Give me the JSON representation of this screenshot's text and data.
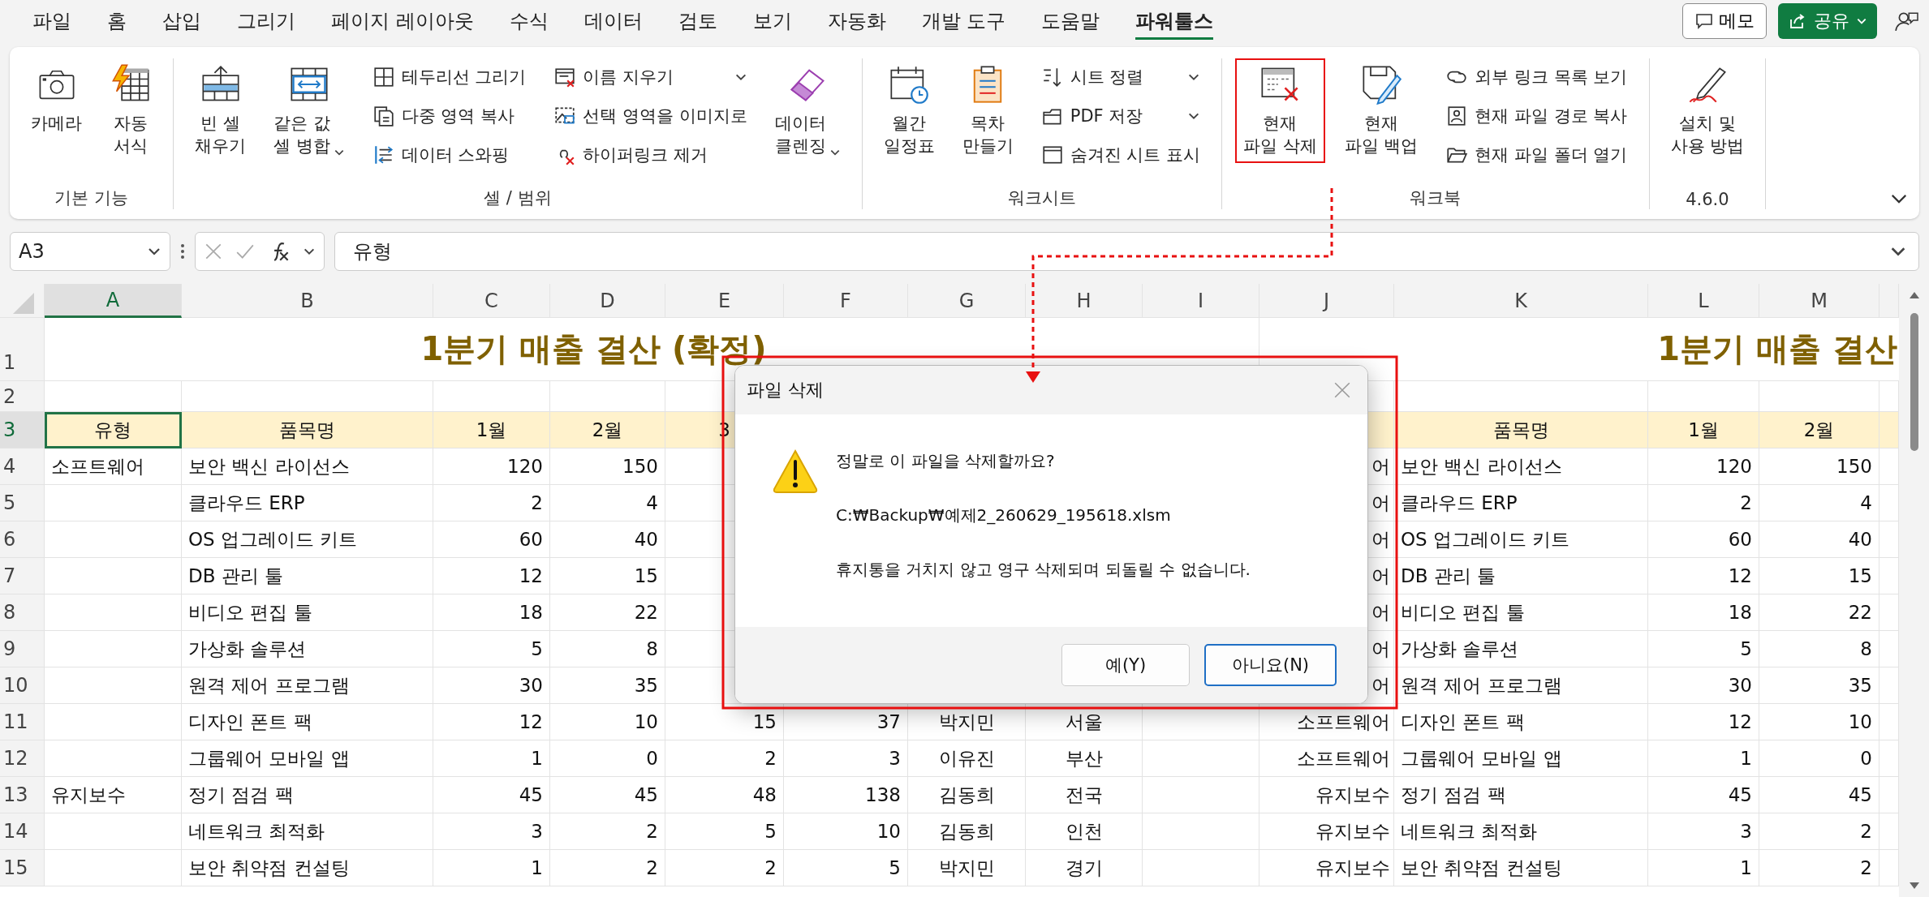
{
  "menu_tabs": [
    {
      "label": "파일",
      "selected": false
    },
    {
      "label": "홈",
      "selected": false
    },
    {
      "label": "삽입",
      "selected": false
    },
    {
      "label": "그리기",
      "selected": false
    },
    {
      "label": "페이지 레이아웃",
      "selected": false
    },
    {
      "label": "수식",
      "selected": false
    },
    {
      "label": "데이터",
      "selected": false
    },
    {
      "label": "검토",
      "selected": false
    },
    {
      "label": "보기",
      "selected": false
    },
    {
      "label": "자동화",
      "selected": false
    },
    {
      "label": "개발 도구",
      "selected": false
    },
    {
      "label": "도움말",
      "selected": false
    },
    {
      "label": "파워툴스",
      "selected": true
    }
  ],
  "header_buttons": {
    "memo": "메모",
    "share": "공유"
  },
  "ribbon": {
    "groups": [
      {
        "name": "기본 기능",
        "items": [
          {
            "kind": "large",
            "label": "카메라",
            "has_menu": false,
            "highlighted": false
          },
          {
            "kind": "large",
            "label": "자동\n서식",
            "has_menu": false,
            "highlighted": false
          }
        ]
      },
      {
        "name": "셀 / 범위",
        "items": [
          {
            "kind": "large",
            "label": "빈 셀\n채우기",
            "has_menu": false,
            "highlighted": false
          },
          {
            "kind": "large",
            "label": "같은 값\n셀 병합",
            "has_menu": true,
            "highlighted": false
          },
          {
            "kind": "stack",
            "items": [
              {
                "label": "테두리선 그리기",
                "has_menu": false
              },
              {
                "label": "다중 영역 복사",
                "has_menu": false
              },
              {
                "label": "데이터 스와핑",
                "has_menu": false
              }
            ]
          },
          {
            "kind": "stack",
            "items": [
              {
                "label": "이름 지우기",
                "has_menu": true
              },
              {
                "label": "선택 영역을 이미지로",
                "has_menu": false
              },
              {
                "label": "하이퍼링크 제거",
                "has_menu": false
              }
            ]
          },
          {
            "kind": "large",
            "label": "데이터\n클렌징",
            "has_menu": true,
            "highlighted": false
          }
        ]
      },
      {
        "name": "워크시트",
        "items": [
          {
            "kind": "large",
            "label": "월간\n일정표",
            "has_menu": false,
            "highlighted": false
          },
          {
            "kind": "large",
            "label": "목차\n만들기",
            "has_menu": false,
            "highlighted": false
          },
          {
            "kind": "stack",
            "items": [
              {
                "label": "시트 정렬",
                "has_menu": true
              },
              {
                "label": "PDF 저장",
                "has_menu": true
              },
              {
                "label": "숨겨진 시트 표시",
                "has_menu": false
              }
            ]
          }
        ]
      },
      {
        "name": "워크북",
        "items": [
          {
            "kind": "large",
            "label": "현재\n파일 삭제",
            "has_menu": false,
            "highlighted": true
          },
          {
            "kind": "large",
            "label": "현재\n파일 백업",
            "has_menu": false,
            "highlighted": false
          },
          {
            "kind": "stack",
            "items": [
              {
                "label": "외부 링크 목록 보기",
                "has_menu": false
              },
              {
                "label": "현재 파일 경로 복사",
                "has_menu": false
              },
              {
                "label": "현재 파일 폴더 열기",
                "has_menu": false
              }
            ]
          }
        ]
      },
      {
        "name": "4.6.0",
        "items": [
          {
            "kind": "large",
            "label": "설치 및\n사용 방법",
            "has_menu": false,
            "highlighted": false
          }
        ]
      }
    ]
  },
  "formula_bar": {
    "name_box": "A3",
    "formula": "유형"
  },
  "sheet": {
    "columns": [
      {
        "label": "A",
        "selected": true
      },
      {
        "label": "B",
        "selected": false
      },
      {
        "label": "C",
        "selected": false
      },
      {
        "label": "D",
        "selected": false
      },
      {
        "label": "E",
        "selected": false
      },
      {
        "label": "F",
        "selected": false
      },
      {
        "label": "G",
        "selected": false
      },
      {
        "label": "H",
        "selected": false
      },
      {
        "label": "I",
        "selected": false
      },
      {
        "label": "J",
        "selected": false
      },
      {
        "label": "K",
        "selected": false
      },
      {
        "label": "L",
        "selected": false
      },
      {
        "label": "M",
        "selected": false
      }
    ],
    "rows": [
      {
        "number": "1",
        "kind": "title",
        "selected": false,
        "title_left": "1분기 매출 결산 (확정)",
        "title_right": "1분기 매출 결산"
      },
      {
        "number": "2",
        "kind": "blank",
        "selected": false
      },
      {
        "number": "3",
        "kind": "header",
        "selected": true,
        "cells": {
          "A": "유형",
          "B": "품목명",
          "C": "1월",
          "D": "2월",
          "E": "3",
          "K": "품목명",
          "L": "1월",
          "M": "2월"
        }
      },
      {
        "number": "4",
        "kind": "data",
        "selected": false,
        "cells": {
          "A": "소프트웨어",
          "B": "보안 백신 라이선스",
          "C": "120",
          "D": "150",
          "J": "어",
          "K": "보안 백신 라이선스",
          "L": "120",
          "M": "150"
        }
      },
      {
        "number": "5",
        "kind": "data",
        "selected": false,
        "cells": {
          "B": "클라우드 ERP",
          "C": "2",
          "D": "4",
          "J": "어",
          "K": "클라우드 ERP",
          "L": "2",
          "M": "4"
        }
      },
      {
        "number": "6",
        "kind": "data",
        "selected": false,
        "cells": {
          "B": "OS 업그레이드 키트",
          "C": "60",
          "D": "40",
          "J": "어",
          "K": "OS 업그레이드 키트",
          "L": "60",
          "M": "40"
        }
      },
      {
        "number": "7",
        "kind": "data",
        "selected": false,
        "cells": {
          "B": "DB 관리 툴",
          "C": "12",
          "D": "15",
          "J": "어",
          "K": "DB 관리 툴",
          "L": "12",
          "M": "15"
        }
      },
      {
        "number": "8",
        "kind": "data",
        "selected": false,
        "cells": {
          "B": "비디오 편집 툴",
          "C": "18",
          "D": "22",
          "J": "어",
          "K": "비디오 편집 툴",
          "L": "18",
          "M": "22"
        }
      },
      {
        "number": "9",
        "kind": "data",
        "selected": false,
        "cells": {
          "B": "가상화 솔루션",
          "C": "5",
          "D": "8",
          "J": "어",
          "K": "가상화 솔루션",
          "L": "5",
          "M": "8"
        }
      },
      {
        "number": "10",
        "kind": "data",
        "selected": false,
        "cells": {
          "B": "원격 제어 프로그램",
          "C": "30",
          "D": "35",
          "J": "어",
          "K": "원격 제어 프로그램",
          "L": "30",
          "M": "35"
        }
      },
      {
        "number": "11",
        "kind": "data",
        "selected": false,
        "cells": {
          "B": "디자인 폰트 팩",
          "C": "12",
          "D": "10",
          "E": "15",
          "F": "37",
          "G": "박지민",
          "H": "서울",
          "J": "소프트웨어",
          "K": "디자인 폰트 팩",
          "L": "12",
          "M": "10"
        }
      },
      {
        "number": "12",
        "kind": "data",
        "selected": false,
        "cells": {
          "B": "그룹웨어 모바일 앱",
          "C": "1",
          "D": "0",
          "E": "2",
          "F": "3",
          "G": "이유진",
          "H": "부산",
          "J": "소프트웨어",
          "K": "그룹웨어 모바일 앱",
          "L": "1",
          "M": "0"
        }
      },
      {
        "number": "13",
        "kind": "data",
        "selected": false,
        "cells": {
          "A": "유지보수",
          "B": "정기 점검 팩",
          "C": "45",
          "D": "45",
          "E": "48",
          "F": "138",
          "G": "김동희",
          "H": "전국",
          "J": "유지보수",
          "K": "정기 점검 팩",
          "L": "45",
          "M": "45"
        }
      },
      {
        "number": "14",
        "kind": "data",
        "selected": false,
        "cells": {
          "B": "네트워크 최적화",
          "C": "3",
          "D": "2",
          "E": "5",
          "F": "10",
          "G": "김동희",
          "H": "인천",
          "J": "유지보수",
          "K": "네트워크 최적화",
          "L": "3",
          "M": "2"
        }
      },
      {
        "number": "15",
        "kind": "data",
        "selected": false,
        "cells": {
          "B": "보안 취약점 컨설팅",
          "C": "1",
          "D": "2",
          "E": "2",
          "F": "5",
          "G": "박지민",
          "H": "경기",
          "J": "유지보수",
          "K": "보안 취약점 컨설팅",
          "L": "1",
          "M": "2"
        }
      }
    ]
  },
  "dialog": {
    "title": "파일 삭제",
    "highlighted": true,
    "messages": [
      "정말로 이 파일을 삭제할까요?",
      "C:₩Backup₩예제2_260629_195618.xlsm",
      "휴지통을 거치지 않고 영구 삭제되며 되돌릴 수 없습니다."
    ],
    "buttons": [
      {
        "label": "예(Y)",
        "default": false
      },
      {
        "label": "아니요(N)",
        "default": true
      }
    ]
  }
}
